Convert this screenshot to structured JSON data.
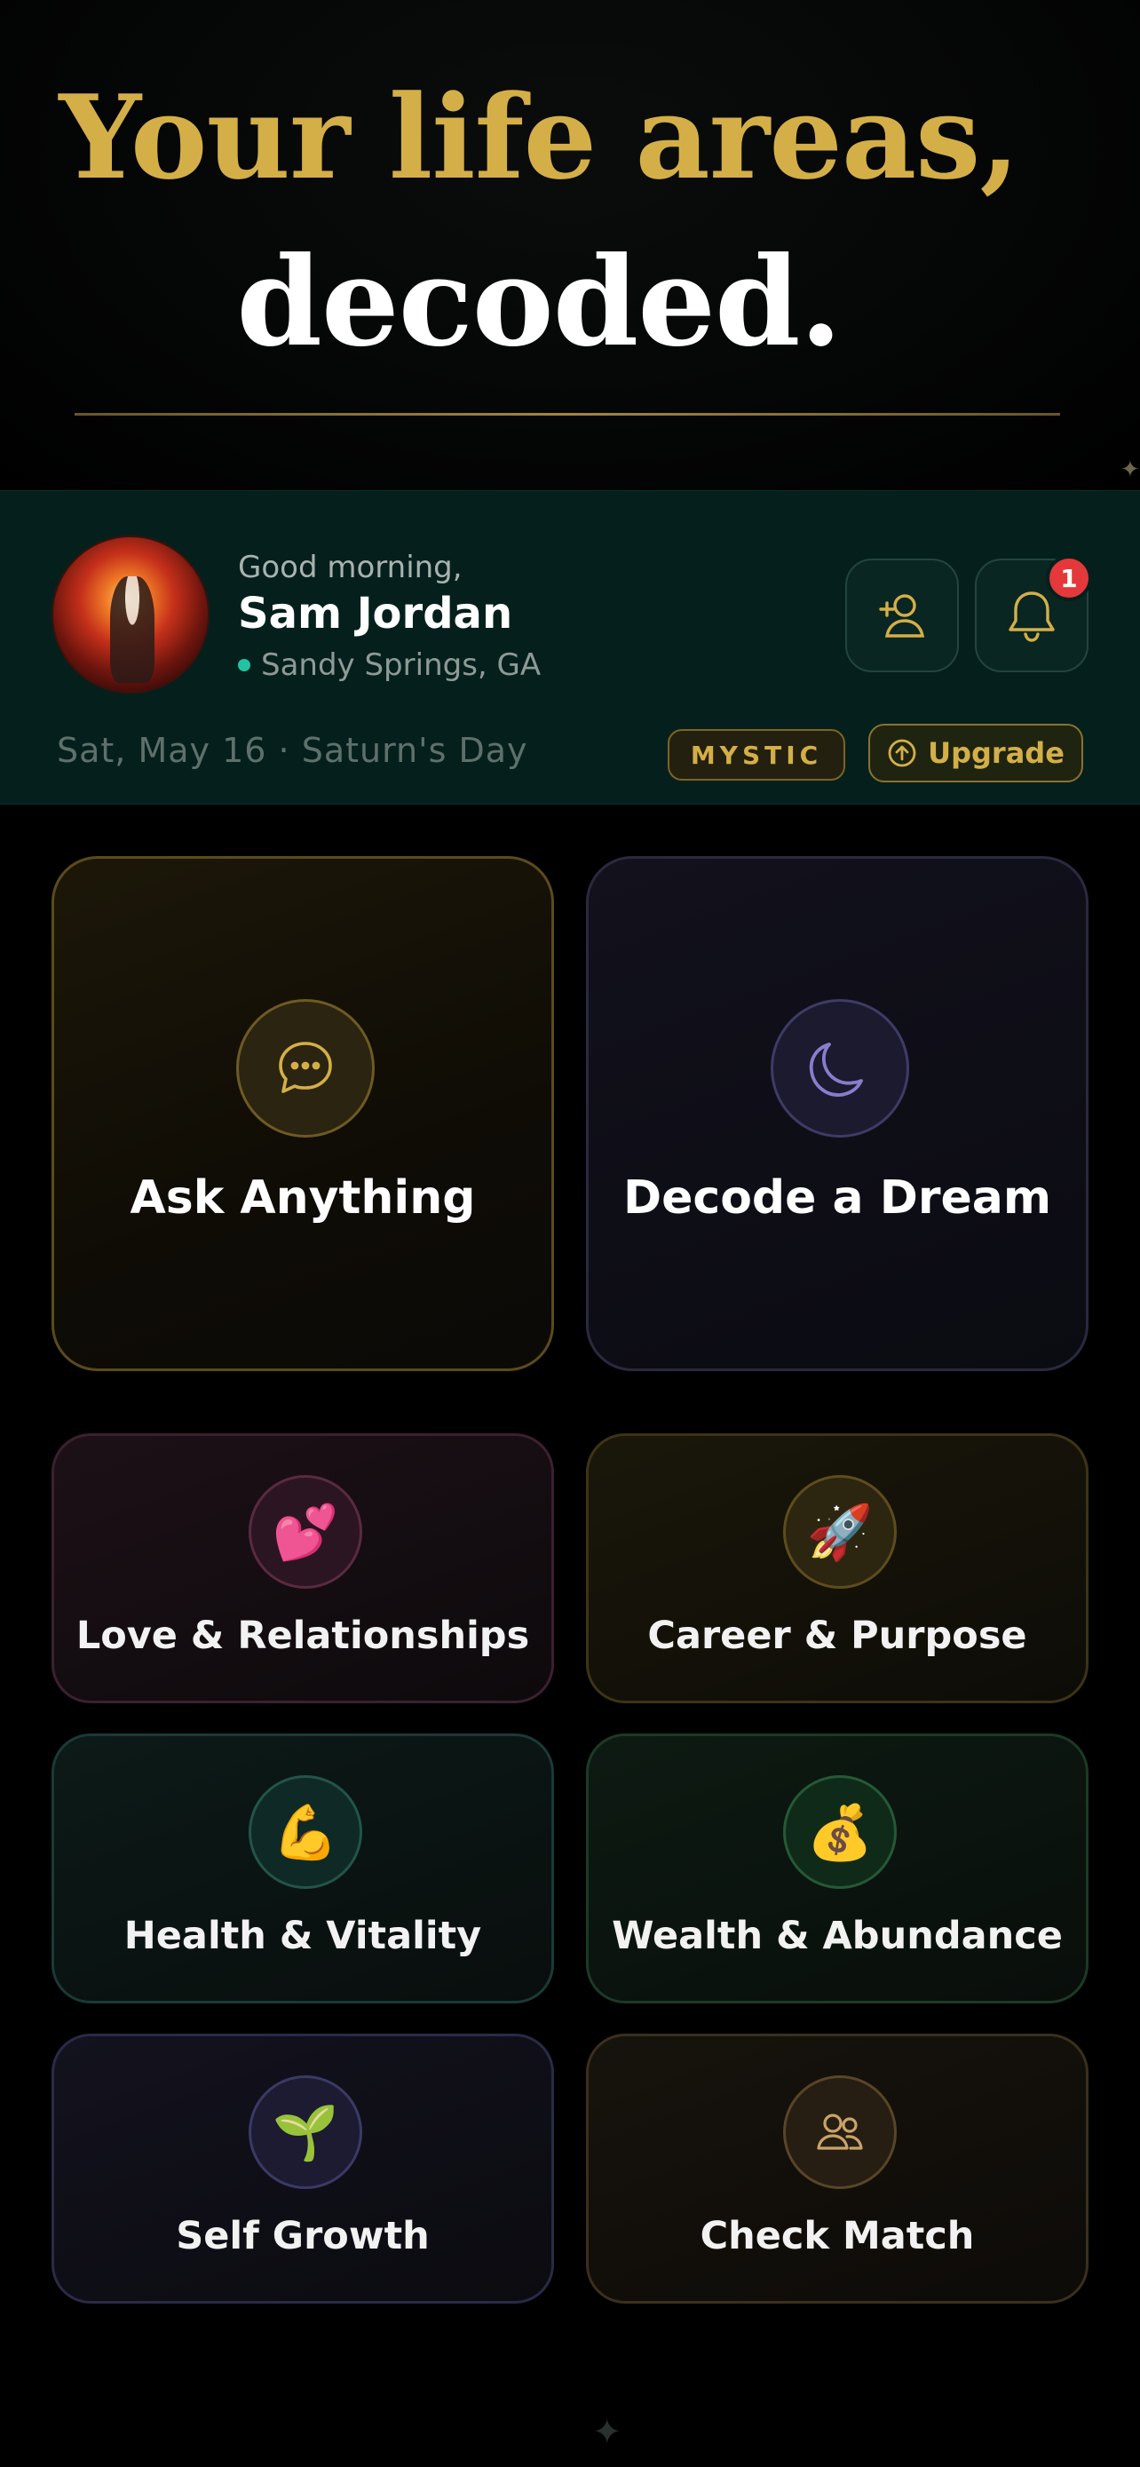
{
  "hero": {
    "line1": "Your life areas,",
    "line2": "decoded."
  },
  "profile": {
    "greeting": "Good morning,",
    "name": "Sam Jordan",
    "location": "Sandy Springs, GA",
    "date": "Sat, May 16 · Saturn's Day",
    "tier": "MYSTIC",
    "upgrade_label": "Upgrade",
    "notification_count": "1",
    "add_friend_icon": "user-plus-icon",
    "bell_icon": "bell-icon"
  },
  "primary_actions": [
    {
      "label": "Ask Anything",
      "icon": "chat-bubble-icon"
    },
    {
      "label": "Decode a Dream",
      "icon": "moon-icon"
    }
  ],
  "life_areas": [
    {
      "label": "Love & Relationships",
      "emoji": "💕"
    },
    {
      "label": "Career & Purpose",
      "emoji": "🚀"
    },
    {
      "label": "Health & Vitality",
      "emoji": "💪"
    },
    {
      "label": "Wealth & Abundance",
      "emoji": "💰"
    },
    {
      "label": "Self Growth",
      "emoji": "🌱"
    },
    {
      "label": "Check Match",
      "icon": "users-icon"
    }
  ],
  "colors": {
    "gold": "#d4af48",
    "teal_bg": "#05201c",
    "badge_red": "#e5383b",
    "online_dot": "#21c3a3"
  }
}
